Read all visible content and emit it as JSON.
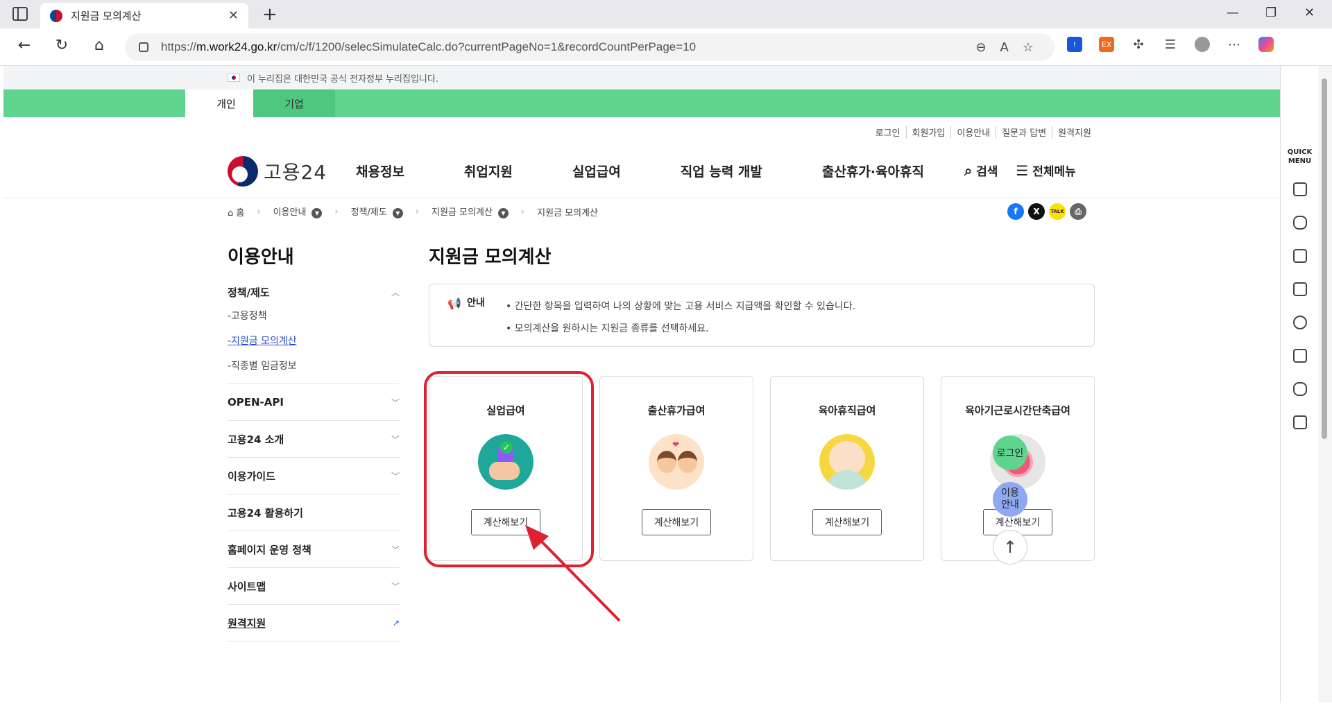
{
  "browser": {
    "tab_title": "지원금 모의계산",
    "url_prefix": "https://",
    "url_domain": "m.work24.go.kr",
    "url_path": "/cm/c/f/1200/selecSimulateCalc.do?currentPageNo=1&recordCountPerPage=10"
  },
  "gov_banner": "이 누리집은 대한민국 공식 전자정부 누리집입니다.",
  "audience_tabs": [
    "개인",
    "기업"
  ],
  "util_links": [
    "로그인",
    "회원가입",
    "이용안내",
    "질문과 답변",
    "원격지원"
  ],
  "logo_text": "고용24",
  "gnb": [
    "채용정보",
    "취업지원",
    "실업급여",
    "직업 능력 개발",
    "출산휴가·육아휴직"
  ],
  "search_label": "검색",
  "allmenu_label": "전체메뉴",
  "breadcrumb": [
    "홈",
    "이용안내",
    "정책/제도",
    "지원금 모의계산",
    "지원금 모의계산"
  ],
  "sidebar": {
    "title": "이용안내",
    "section_open": "정책/제도",
    "sub_items": [
      "-고용정책",
      "-지원금 모의계산",
      "-직종별 임금정보"
    ],
    "items": [
      "OPEN-API",
      "고용24 소개",
      "이용가이드",
      "고용24 활용하기",
      "홈페이지 운영 정책",
      "사이트맵",
      "원격지원"
    ]
  },
  "main": {
    "title": "지원금 모의계산",
    "notice_label": "안내",
    "notice_lines": [
      "간단한 항목을 입력하여 나의 상황에 맞는 고용 서비스 지급액을 확인할 수 있습니다.",
      "모의계산을 원하시는 지원금 종류를 선택하세요."
    ],
    "cards": [
      {
        "title": "실업급여",
        "button": "계산해보기"
      },
      {
        "title": "출산휴가급여",
        "button": "계산해보기"
      },
      {
        "title": "육아휴직급여",
        "button": "계산해보기"
      },
      {
        "title": "육아기근로시간단축급여",
        "button": "계산해보기"
      }
    ]
  },
  "floating": {
    "login": "로그인",
    "guide_line1": "이용",
    "guide_line2": "안내",
    "top": "↑"
  },
  "quick_menu": {
    "label_line1": "QUICK",
    "label_line2": "MENU"
  },
  "colors": {
    "green": "#5fd48e",
    "annotation": "#e02030",
    "link_blue": "#2a4dd0"
  }
}
